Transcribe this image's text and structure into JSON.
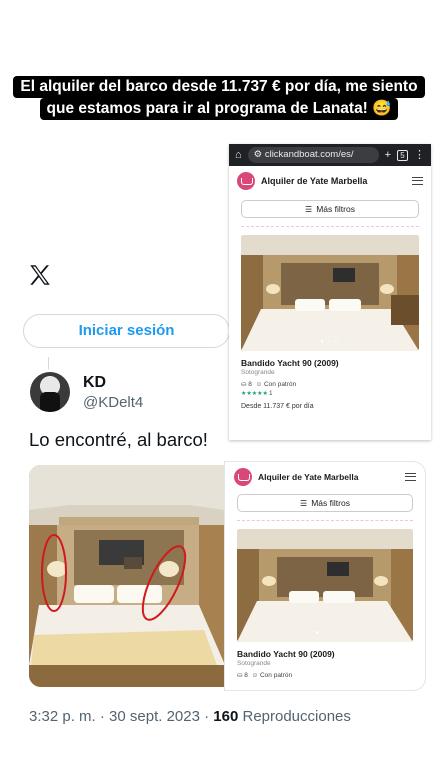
{
  "caption": {
    "line1": "El alquiler del barco desde 11.737 € por día, me siento",
    "line2": "que estamos para ir al programa de Lanata! 😅"
  },
  "tweet": {
    "login_label": "Iniciar sesión",
    "author_name": "KD",
    "author_handle": "@KDelt4",
    "text": "Lo encontré, al barco!",
    "time": "3:32 p. m. · 30 sept. 2023 ·",
    "views_count": "160",
    "views_label": "Reproducciones"
  },
  "browser": {
    "url": "clickandboat.com/es/",
    "tabs_count": "5",
    "site_title": "Alquiler de Yate Marbella",
    "filters_label": "Más filtros",
    "listing": {
      "title": "Bandido Yacht 90 (2009)",
      "location": "Sotogrande",
      "guests": "8",
      "skipper": "Con patrón",
      "stars": "★★★★★",
      "reviews": "1",
      "price": "Desde 11.737 € por día"
    }
  },
  "site2": {
    "site_title": "Alquiler de Yate Marbella",
    "filters_label": "Más filtros",
    "listing": {
      "title": "Bandido Yacht 90 (2009)",
      "location": "Sotogrande",
      "guests": "8",
      "skipper": "Con patrón"
    }
  },
  "colors": {
    "x_blue": "#1d9bf0",
    "brand_pink": "#d8497a",
    "highlight_red": "#d0191b"
  }
}
